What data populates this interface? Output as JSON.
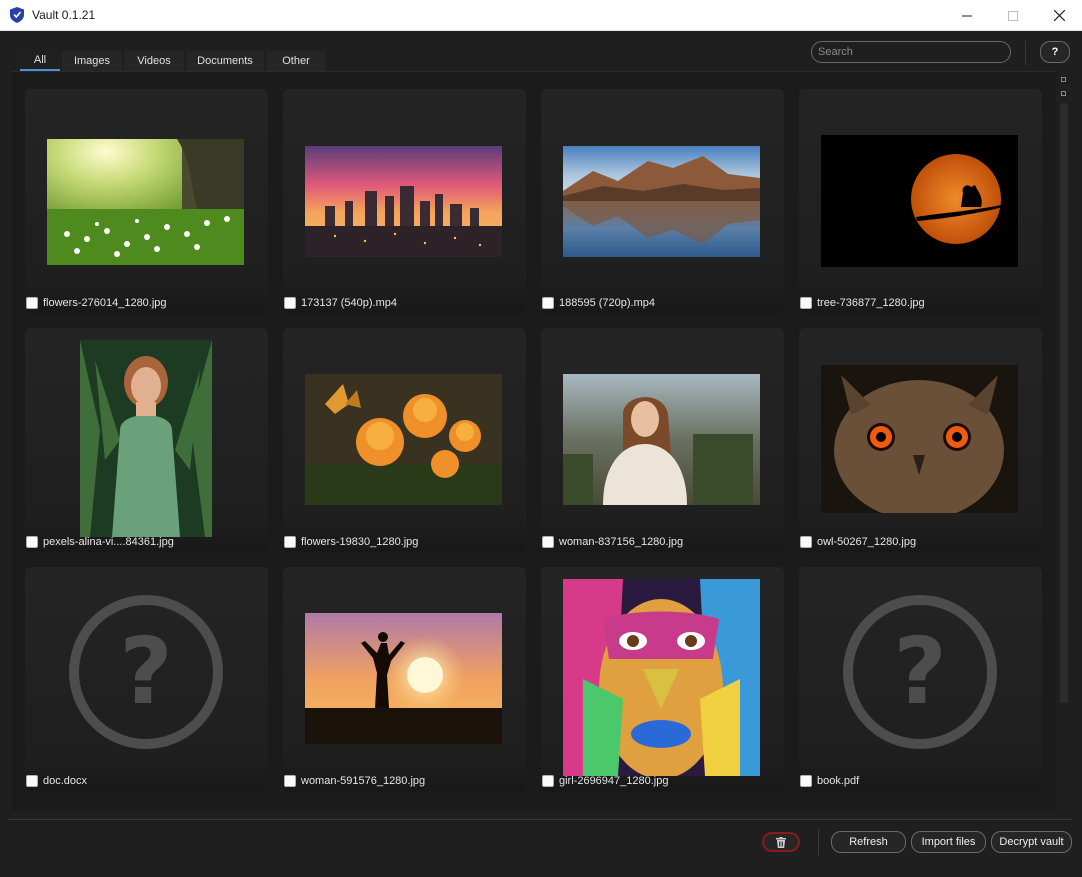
{
  "window": {
    "title": "Vault 0.1.21"
  },
  "tabs": [
    {
      "label": "All"
    },
    {
      "label": "Images"
    },
    {
      "label": "Videos"
    },
    {
      "label": "Documents"
    },
    {
      "label": "Other"
    }
  ],
  "search": {
    "placeholder": "Search"
  },
  "help": {
    "label": "?"
  },
  "files": [
    {
      "name": "flowers-276014_1280.jpg",
      "icon": "image-thumbnail"
    },
    {
      "name": "173137 (540p).mp4",
      "icon": "video-thumbnail"
    },
    {
      "name": "188595 (720p).mp4",
      "icon": "video-thumbnail"
    },
    {
      "name": "tree-736877_1280.jpg",
      "icon": "image-thumbnail"
    },
    {
      "name": "pexels-alina-vi....84361.jpg",
      "icon": "image-thumbnail"
    },
    {
      "name": "flowers-19830_1280.jpg",
      "icon": "image-thumbnail"
    },
    {
      "name": "woman-837156_1280.jpg",
      "icon": "image-thumbnail"
    },
    {
      "name": "owl-50267_1280.jpg",
      "icon": "image-thumbnail"
    },
    {
      "name": "doc.docx",
      "icon": "unknown-file-icon"
    },
    {
      "name": "woman-591576_1280.jpg",
      "icon": "image-thumbnail"
    },
    {
      "name": "girl-2696947_1280.jpg",
      "icon": "image-thumbnail"
    },
    {
      "name": "book.pdf",
      "icon": "unknown-file-icon"
    }
  ],
  "unknown_glyph": "?",
  "actions": {
    "refresh": "Refresh",
    "import": "Import files",
    "decrypt": "Decrypt vault"
  },
  "colors": {
    "accent": "#4a90d9",
    "delete_border": "#8b1a1a",
    "background": "#1f1f1f"
  }
}
